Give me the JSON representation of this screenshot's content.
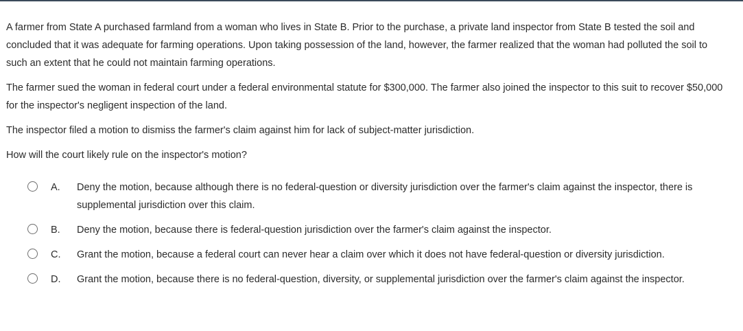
{
  "question": {
    "paragraphs": [
      "A farmer from State A purchased farmland from a woman who lives in State B.  Prior to the purchase, a private land inspector from State B tested the soil and concluded that it was adequate for farming operations.  Upon taking possession of the land, however, the farmer realized that the woman had polluted the soil to such an extent that he could not maintain farming operations.",
      "The farmer sued the woman in federal court under a federal environmental statute for $300,000.  The farmer also joined the inspector to this suit to recover $50,000 for the inspector's negligent inspection of the land.",
      "The inspector filed a motion to dismiss the farmer's claim against him for lack of subject-matter jurisdiction.",
      "How will the court likely rule on the inspector's motion?"
    ]
  },
  "choices": [
    {
      "letter": "A.",
      "text": "Deny the motion, because although there is no federal-question or diversity jurisdiction over the farmer's claim against the inspector, there is supplemental jurisdiction over this claim."
    },
    {
      "letter": "B.",
      "text": "Deny the motion, because there is federal-question jurisdiction over the farmer's claim against the inspector."
    },
    {
      "letter": "C.",
      "text": "Grant the motion, because a federal court can never hear a claim over which it does not have federal-question or diversity jurisdiction."
    },
    {
      "letter": "D.",
      "text": "Grant the motion, because there is no federal-question, diversity, or supplemental jurisdiction over the farmer's claim against the inspector."
    }
  ]
}
